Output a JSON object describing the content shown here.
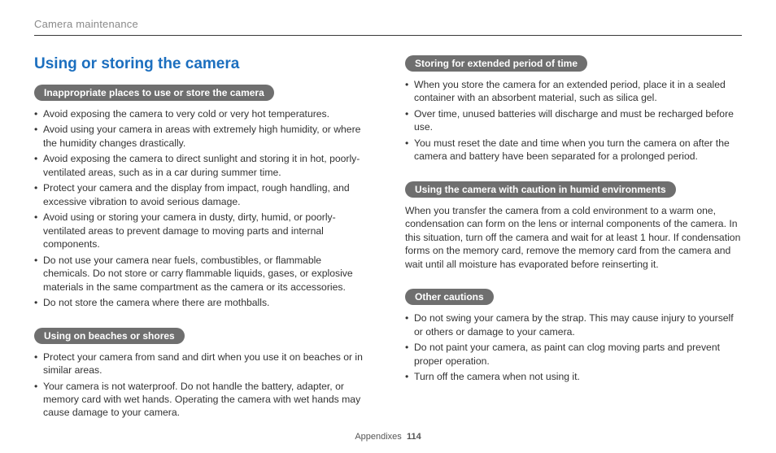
{
  "header": {
    "breadcrumb": "Camera maintenance"
  },
  "title": "Using or storing the camera",
  "left": {
    "sec1": {
      "heading": "Inappropriate places to use or store the camera",
      "items": [
        "Avoid exposing the camera to very cold or very hot temperatures.",
        "Avoid using your camera in areas with extremely high humidity, or where the humidity changes drastically.",
        "Avoid exposing the camera to direct sunlight and storing it in hot, poorly-ventilated areas, such as in a car during summer time.",
        "Protect your camera and the display from impact, rough handling, and excessive vibration to avoid serious damage.",
        "Avoid using or storing your camera in dusty, dirty, humid, or poorly-ventilated areas to prevent damage to moving parts and internal components.",
        "Do not use your camera near fuels, combustibles, or flammable chemicals. Do not store or carry flammable liquids, gases, or explosive materials in the same compartment as the camera or its accessories.",
        "Do not store the camera where there are mothballs."
      ]
    },
    "sec2": {
      "heading": "Using on beaches or shores",
      "items": [
        "Protect your camera from sand and dirt when you use it on beaches or in similar areas.",
        "Your camera is not waterproof. Do not handle the battery, adapter, or memory card with wet hands. Operating the camera with wet hands may cause damage to your camera."
      ]
    }
  },
  "right": {
    "sec1": {
      "heading": "Storing for extended period of time",
      "items": [
        "When you store the camera for an extended period, place it in a sealed container with an absorbent material, such as silica gel.",
        "Over time, unused batteries will discharge and must be recharged before use.",
        "You must reset the date and time when you turn the camera on after the camera and battery have been separated for a prolonged period."
      ]
    },
    "sec2": {
      "heading": "Using the camera with caution in humid environments",
      "body": "When you transfer the camera from a cold environment to a warm one, condensation can form on the lens or internal components of the camera. In this situation, turn off the camera and wait for at least 1 hour. If condensation forms on the memory card, remove the memory card from the camera and wait until all moisture has evaporated before reinserting it."
    },
    "sec3": {
      "heading": "Other cautions",
      "items": [
        "Do not swing your camera by the strap. This may cause injury to yourself or others or damage to your camera.",
        "Do not paint your camera, as paint can clog moving parts and prevent proper operation.",
        "Turn off the camera when not using it."
      ]
    }
  },
  "footer": {
    "label": "Appendixes",
    "page": "114"
  }
}
